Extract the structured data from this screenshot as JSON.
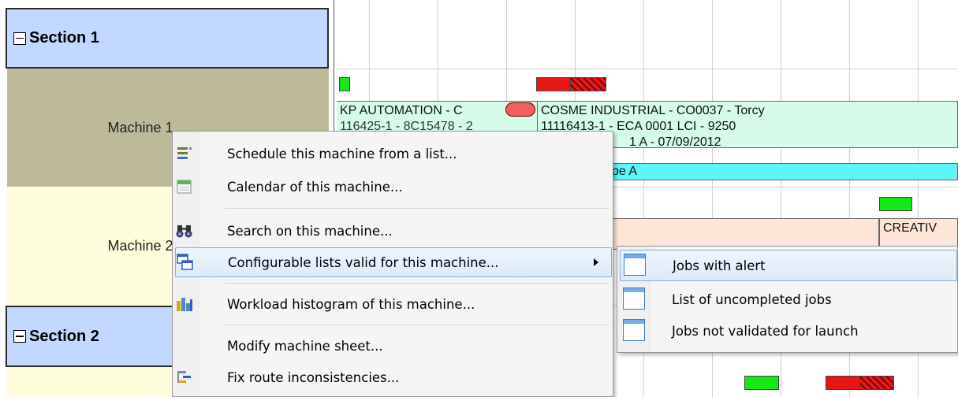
{
  "resources": {
    "section1": "Section 1",
    "machine1": "Machine 1",
    "machine2": "Machine 2",
    "section2": "Section 2"
  },
  "jobs": {
    "row1_left": [
      "KP AUTOMATION - C",
      "116425-1 - 8C15478 - 2"
    ],
    "row1_main": [
      "COSME INDUSTRIAL - CO0037 - Torcy",
      "11116413-1 - ECA 0001 LCI - 9250",
      "1 A - 07/09/2012"
    ],
    "row1_type": "ype A",
    "row2_right": "CREATIV"
  },
  "context_menu": {
    "items": [
      {
        "label": "Schedule this machine from a list...",
        "icon": "list-lines-icon"
      },
      {
        "label": "Calendar of this machine...",
        "icon": "calendar-icon"
      },
      {
        "label": "Search on this machine...",
        "icon": "binoculars-icon"
      },
      {
        "label": "Configurable lists valid for this machine...",
        "icon": "windows-icon"
      },
      {
        "label": "Workload histogram of this machine...",
        "icon": "histogram-icon"
      },
      {
        "label": "Modify machine sheet...",
        "icon": ""
      },
      {
        "label": "Fix route inconsistencies...",
        "icon": "route-icon"
      }
    ]
  },
  "submenu": {
    "items": [
      {
        "label": "Jobs with alert"
      },
      {
        "label": "List of uncompleted jobs"
      },
      {
        "label": "Jobs not validated for launch"
      }
    ]
  },
  "colors": {
    "section_bg": "#c2d8ff",
    "machine1_bg": "#bdba9a",
    "machine2_bg": "#fefedd",
    "job_green_bg": "#d6fbe9",
    "job_type_bg": "#5cf6fa",
    "job_peach_bg": "#fde6d6",
    "bar_red": "#e81616",
    "bar_green": "#16e816"
  }
}
